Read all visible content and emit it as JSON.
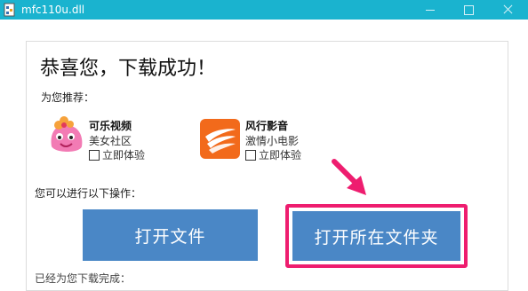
{
  "window": {
    "title": "mfc110u.dll",
    "app_icon": "dll-file-icon",
    "colors": {
      "titlebar": "#1ab3cf"
    }
  },
  "main": {
    "headline": "恭喜您，下载成功！",
    "recommend_label": "为您推荐：",
    "recommendations": [
      {
        "icon": "keke-video-icon",
        "name": "可乐视频",
        "subtitle": "美女社区",
        "check_label": "立即体验",
        "checked": false
      },
      {
        "icon": "fengxing-icon",
        "name": "风行影音",
        "subtitle": "激情小电影",
        "check_label": "立即体验",
        "checked": false
      }
    ],
    "ops_label": "您可以进行以下操作：",
    "buttons": {
      "open_file": "打开文件",
      "open_folder": "打开所在文件夹"
    },
    "bottom_text": "已经为您下载完成："
  },
  "colors": {
    "button": "#4a87c6",
    "highlight": "#ee1d6f"
  }
}
